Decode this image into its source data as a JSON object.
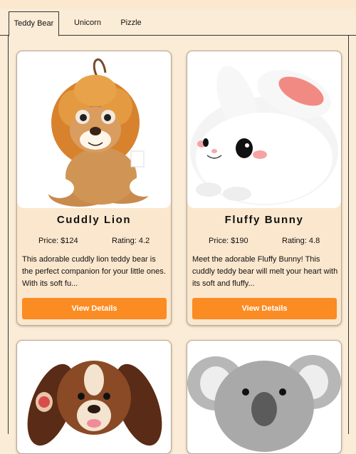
{
  "tabs": [
    {
      "label": "Teddy Bear",
      "active": true
    },
    {
      "label": "Unicorn",
      "active": false
    },
    {
      "label": "Pizzle",
      "active": false
    }
  ],
  "products": [
    {
      "name": "Cuddly Lion",
      "price": "Price: $124",
      "rating": "Rating: 4.2",
      "description": "This adorable cuddly lion teddy bear is the perfect companion for your little ones. With its soft fu...",
      "button": "View Details",
      "image": "lion-plush-icon"
    },
    {
      "name": "Fluffy Bunny",
      "price": "Price: $190",
      "rating": "Rating: 4.8",
      "description": "Meet the adorable Fluffy Bunny! This cuddly teddy bear will melt your heart with its soft and fluffy...",
      "button": "View Details",
      "image": "bunny-plush-icon"
    },
    {
      "image": "puppy-plush-icon"
    },
    {
      "image": "koala-plush-icon"
    }
  ],
  "colors": {
    "background": "#fbecd7",
    "card": "#fbe7cd",
    "button": "#fb8b23"
  }
}
